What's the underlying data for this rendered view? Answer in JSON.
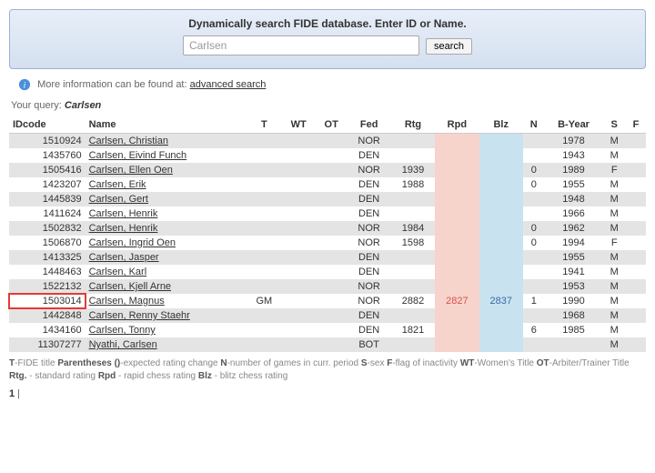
{
  "search": {
    "title": "Dynamically search FIDE database. Enter ID or Name.",
    "placeholder": "Carlsen",
    "button": "search"
  },
  "info": {
    "text": "More information can be found at: ",
    "link": "advanced search"
  },
  "query": {
    "label": "Your query: ",
    "value": "Carlsen"
  },
  "headers": {
    "id": "IDcode",
    "name": "Name",
    "t": "T",
    "wt": "WT",
    "ot": "OT",
    "fed": "Fed",
    "rtg": "Rtg",
    "rpd": "Rpd",
    "blz": "Blz",
    "n": "N",
    "byear": "B-Year",
    "s": "S",
    "f": "F"
  },
  "rows": [
    {
      "id": "1510924",
      "name": "Carlsen, Christian",
      "t": "",
      "wt": "",
      "ot": "",
      "fed": "NOR",
      "rtg": "",
      "rpd": "",
      "blz": "",
      "n": "",
      "byear": "1978",
      "s": "M",
      "f": ""
    },
    {
      "id": "1435760",
      "name": "Carlsen, Eivind Funch",
      "t": "",
      "wt": "",
      "ot": "",
      "fed": "DEN",
      "rtg": "",
      "rpd": "",
      "blz": "",
      "n": "",
      "byear": "1943",
      "s": "M",
      "f": ""
    },
    {
      "id": "1505416",
      "name": "Carlsen, Ellen Oen",
      "t": "",
      "wt": "",
      "ot": "",
      "fed": "NOR",
      "rtg": "1939",
      "rpd": "",
      "blz": "",
      "n": "0",
      "byear": "1989",
      "s": "F",
      "f": ""
    },
    {
      "id": "1423207",
      "name": "Carlsen, Erik",
      "t": "",
      "wt": "",
      "ot": "",
      "fed": "DEN",
      "rtg": "1988",
      "rpd": "",
      "blz": "",
      "n": "0",
      "byear": "1955",
      "s": "M",
      "f": ""
    },
    {
      "id": "1445839",
      "name": "Carlsen, Gert",
      "t": "",
      "wt": "",
      "ot": "",
      "fed": "DEN",
      "rtg": "",
      "rpd": "",
      "blz": "",
      "n": "",
      "byear": "1948",
      "s": "M",
      "f": ""
    },
    {
      "id": "1411624",
      "name": "Carlsen, Henrik",
      "t": "",
      "wt": "",
      "ot": "",
      "fed": "DEN",
      "rtg": "",
      "rpd": "",
      "blz": "",
      "n": "",
      "byear": "1966",
      "s": "M",
      "f": ""
    },
    {
      "id": "1502832",
      "name": "Carlsen, Henrik",
      "t": "",
      "wt": "",
      "ot": "",
      "fed": "NOR",
      "rtg": "1984",
      "rpd": "",
      "blz": "",
      "n": "0",
      "byear": "1962",
      "s": "M",
      "f": ""
    },
    {
      "id": "1506870",
      "name": "Carlsen, Ingrid Oen",
      "t": "",
      "wt": "",
      "ot": "",
      "fed": "NOR",
      "rtg": "1598",
      "rpd": "",
      "blz": "",
      "n": "0",
      "byear": "1994",
      "s": "F",
      "f": ""
    },
    {
      "id": "1413325",
      "name": "Carlsen, Jasper",
      "t": "",
      "wt": "",
      "ot": "",
      "fed": "DEN",
      "rtg": "",
      "rpd": "",
      "blz": "",
      "n": "",
      "byear": "1955",
      "s": "M",
      "f": ""
    },
    {
      "id": "1448463",
      "name": "Carlsen, Karl",
      "t": "",
      "wt": "",
      "ot": "",
      "fed": "DEN",
      "rtg": "",
      "rpd": "",
      "blz": "",
      "n": "",
      "byear": "1941",
      "s": "M",
      "f": ""
    },
    {
      "id": "1522132",
      "name": "Carlsen, Kjell Arne",
      "t": "",
      "wt": "",
      "ot": "",
      "fed": "NOR",
      "rtg": "",
      "rpd": "",
      "blz": "",
      "n": "",
      "byear": "1953",
      "s": "M",
      "f": ""
    },
    {
      "id": "1503014",
      "name": "Carlsen, Magnus",
      "t": "GM",
      "wt": "",
      "ot": "",
      "fed": "NOR",
      "rtg": "2882",
      "rpd": "2827",
      "blz": "2837",
      "n": "1",
      "byear": "1990",
      "s": "M",
      "f": "",
      "hl": true
    },
    {
      "id": "1442848",
      "name": "Carlsen, Renny Staehr",
      "t": "",
      "wt": "",
      "ot": "",
      "fed": "DEN",
      "rtg": "",
      "rpd": "",
      "blz": "",
      "n": "",
      "byear": "1968",
      "s": "M",
      "f": ""
    },
    {
      "id": "1434160",
      "name": "Carlsen, Tonny",
      "t": "",
      "wt": "",
      "ot": "",
      "fed": "DEN",
      "rtg": "1821",
      "rpd": "",
      "blz": "",
      "n": "6",
      "byear": "1985",
      "s": "M",
      "f": ""
    },
    {
      "id": "11307277",
      "name": "Nyathi, Carlsen",
      "t": "",
      "wt": "",
      "ot": "",
      "fed": "BOT",
      "rtg": "",
      "rpd": "",
      "blz": "",
      "n": "",
      "byear": "",
      "s": "M",
      "f": ""
    }
  ],
  "legend": {
    "t": "T",
    "t_d": "-FIDE title ",
    "p": "Parentheses ()",
    "p_d": "-expected rating change ",
    "n": "N",
    "n_d": "-number of games in curr. period  ",
    "s": "S",
    "s_d": "-sex ",
    "f": "F",
    "f_d": "-flag of inactivity ",
    "wt": "WT",
    "wt_d": "-Women's Title ",
    "ot": "OT",
    "ot_d": "-Arbiter/Trainer Title ",
    "rtg": "Rtg.",
    "rtg_d": " - standard rating  ",
    "rpd": "Rpd",
    "rpd_d": " - rapid chess rating  ",
    "blz": "Blz",
    "blz_d": " - blitz chess rating"
  },
  "page": {
    "current": "1",
    "sep": " |"
  }
}
